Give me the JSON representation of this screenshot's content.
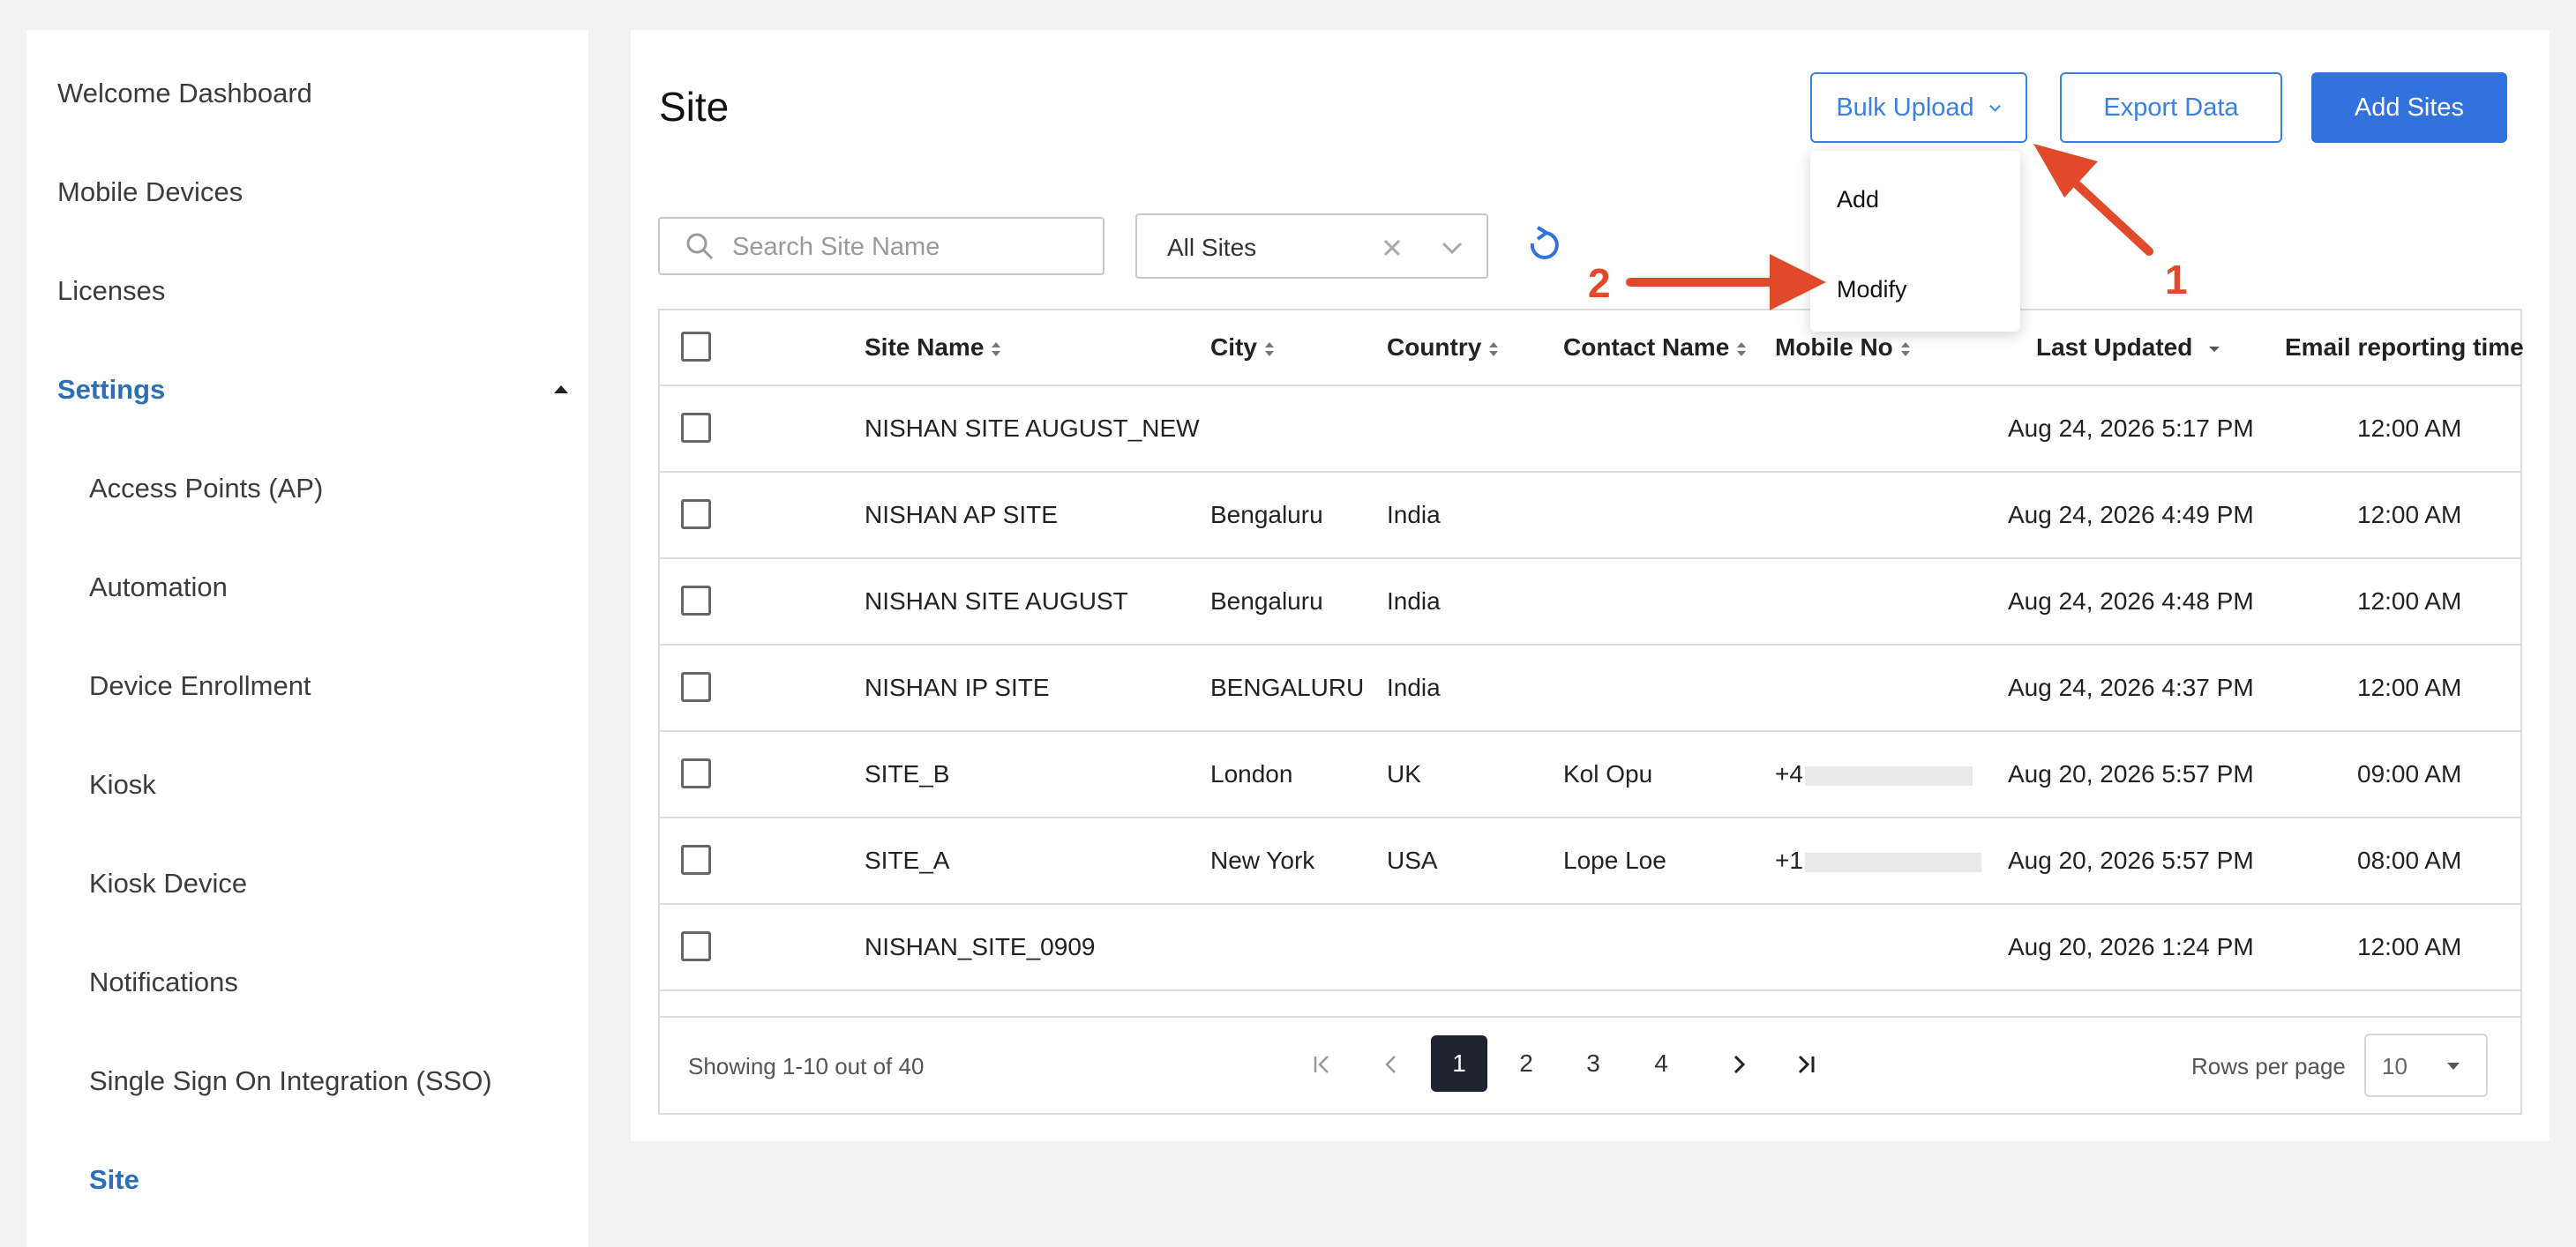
{
  "sidebar": {
    "items": [
      {
        "label": "Welcome Dashboard"
      },
      {
        "label": "Mobile Devices"
      },
      {
        "label": "Licenses"
      },
      {
        "label": "Settings"
      },
      {
        "label": "Access Points (AP)"
      },
      {
        "label": "Automation"
      },
      {
        "label": "Device Enrollment"
      },
      {
        "label": "Kiosk"
      },
      {
        "label": "Kiosk Device"
      },
      {
        "label": "Notifications"
      },
      {
        "label": "Single Sign On Integration (SSO)"
      },
      {
        "label": "Site"
      }
    ]
  },
  "header": {
    "title": "Site",
    "bulk_upload_label": "Bulk Upload",
    "export_label": "Export Data",
    "add_sites_label": "Add Sites"
  },
  "bulk_menu": {
    "items": [
      {
        "label": "Add"
      },
      {
        "label": "Modify"
      }
    ]
  },
  "filters": {
    "search_placeholder": "Search Site Name",
    "site_filter_value": "All Sites"
  },
  "table": {
    "columns": [
      "Site Name",
      "City",
      "Country",
      "Contact Name",
      "Mobile No",
      "Last Updated",
      "Email reporting time"
    ],
    "rows": [
      {
        "site": "NISHAN SITE AUGUST_NEW",
        "city": "",
        "country": "",
        "contact": "",
        "mobile": "",
        "updated": "Aug 24, 2026 5:17 PM",
        "email_time": "12:00 AM"
      },
      {
        "site": "NISHAN AP SITE",
        "city": "Bengaluru",
        "country": "India",
        "contact": "",
        "mobile": "",
        "updated": "Aug 24, 2026 4:49 PM",
        "email_time": "12:00 AM"
      },
      {
        "site": "NISHAN SITE AUGUST",
        "city": "Bengaluru",
        "country": "India",
        "contact": "",
        "mobile": "",
        "updated": "Aug 24, 2026 4:48 PM",
        "email_time": "12:00 AM"
      },
      {
        "site": "NISHAN IP SITE",
        "city": "BENGALURU",
        "country": "India",
        "contact": "",
        "mobile": "",
        "updated": "Aug 24, 2026 4:37 PM",
        "email_time": "12:00 AM"
      },
      {
        "site": "SITE_B",
        "city": "London",
        "country": "UK",
        "contact": "Kol Opu",
        "mobile": "+4",
        "updated": "Aug 20, 2026 5:57 PM",
        "email_time": "09:00 AM"
      },
      {
        "site": "SITE_A",
        "city": "New York",
        "country": "USA",
        "contact": "Lope Loe",
        "mobile": "+1",
        "updated": "Aug 20, 2026 5:57 PM",
        "email_time": "08:00 AM"
      },
      {
        "site": "NISHAN_SITE_0909",
        "city": "",
        "country": "",
        "contact": "",
        "mobile": "",
        "updated": "Aug 20, 2026 1:24 PM",
        "email_time": "12:00 AM"
      }
    ]
  },
  "pagination": {
    "showing": "Showing 1-10 out of 40",
    "pages": [
      "1",
      "2",
      "3",
      "4"
    ],
    "current_page": "1",
    "rows_per_page_label": "Rows per page",
    "rows_per_page_value": "10"
  },
  "annotations": {
    "step1": "1",
    "step2": "2"
  },
  "colors": {
    "accent": "#3272dd",
    "active_nav": "#2d6fb6",
    "annotation": "#e04a2a"
  }
}
